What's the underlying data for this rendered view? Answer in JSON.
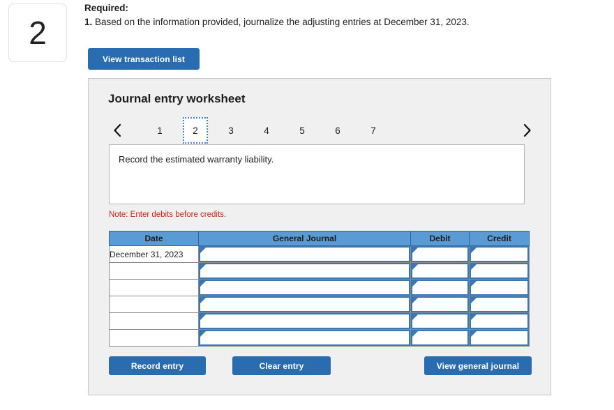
{
  "question": {
    "number": "2"
  },
  "required": {
    "label": "Required:",
    "item_index": "1.",
    "item_text": "Based on the information provided, journalize the adjusting entries at December 31, 2023."
  },
  "toolbar": {
    "view_transaction_list_label": "View transaction list"
  },
  "worksheet": {
    "title": "Journal entry worksheet",
    "prev_icon": "chevron-left-icon",
    "next_icon": "chevron-right-icon",
    "tabs": [
      "1",
      "2",
      "3",
      "4",
      "5",
      "6",
      "7"
    ],
    "active_tab": "2",
    "description": "Record the estimated warranty liability.",
    "note": "Note: Enter debits before credits.",
    "table": {
      "columns": [
        "Date",
        "General Journal",
        "Debit",
        "Credit"
      ],
      "rows": [
        {
          "date": "December 31, 2023",
          "general_journal": "",
          "debit": "",
          "credit": ""
        },
        {
          "date": "",
          "general_journal": "",
          "debit": "",
          "credit": ""
        },
        {
          "date": "",
          "general_journal": "",
          "debit": "",
          "credit": ""
        },
        {
          "date": "",
          "general_journal": "",
          "debit": "",
          "credit": ""
        },
        {
          "date": "",
          "general_journal": "",
          "debit": "",
          "credit": ""
        },
        {
          "date": "",
          "general_journal": "",
          "debit": "",
          "credit": ""
        }
      ]
    },
    "buttons": {
      "record_entry_label": "Record entry",
      "clear_entry_label": "Clear entry",
      "view_general_journal_label": "View general journal"
    }
  },
  "colors": {
    "button_blue": "#2a6cb0",
    "table_header_blue": "#5b9bd5",
    "cell_border_blue": "#3a78b5",
    "note_red": "#c0261d",
    "panel_gray": "#f0f0f0"
  }
}
